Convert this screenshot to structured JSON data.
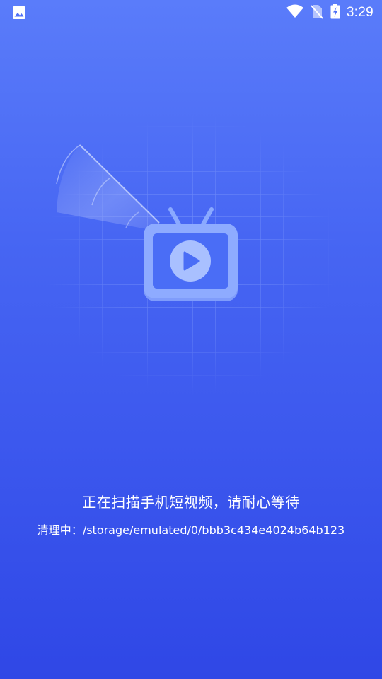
{
  "status_bar": {
    "time": "3:29",
    "icons": [
      "image-notification-icon",
      "wifi-icon",
      "no-sim-icon",
      "battery-charging-icon"
    ]
  },
  "illustration": {
    "icon": "tv-play-icon",
    "effect": "radar-scan-grid"
  },
  "scan": {
    "title": "正在扫描手机短视频，请耐心等待",
    "path_label": "清理中：",
    "path": "/storage/emulated/0/bbb3c434e4024b64b123"
  },
  "colors": {
    "gradient_top": "#5a7cfa",
    "gradient_bottom": "#2f47e6",
    "tv_fill": "#8aa9ff",
    "tv_screen": "#4a6df6",
    "text": "#ffffff"
  }
}
